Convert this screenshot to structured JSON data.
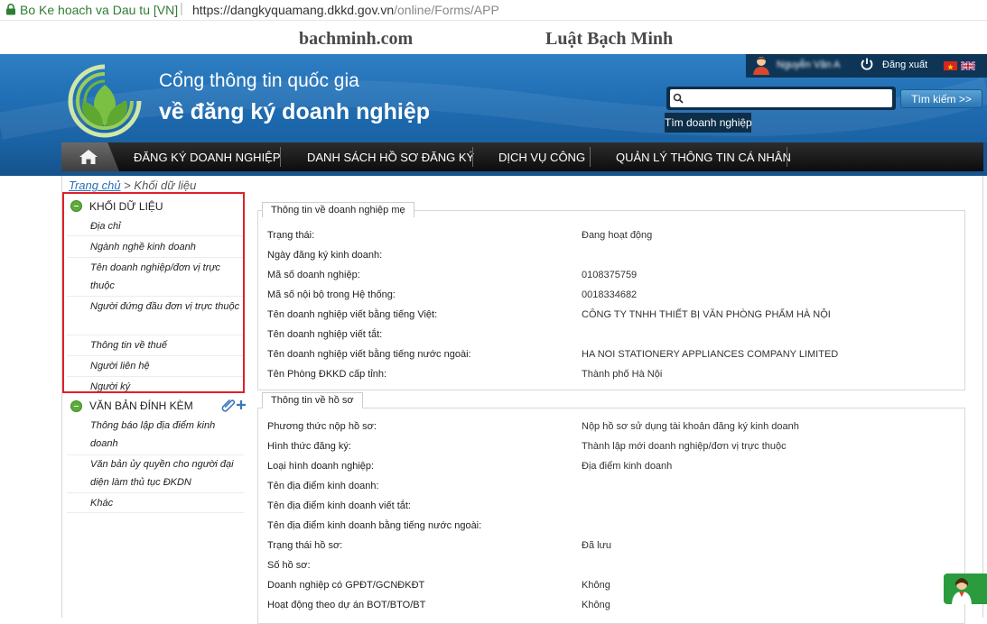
{
  "browser": {
    "site_name": "Bo Ke hoach va Dau tu [VN]",
    "separator": "|",
    "url_host": "https://dangkyquamang.dkkd.gov.vn",
    "url_path": "/online/Forms/APP"
  },
  "watermark": {
    "left": "bachminh.com",
    "right": "Luật Bạch Minh"
  },
  "header": {
    "title_line1": "Cổng thông tin quốc gia",
    "title_line2": "về đăng ký doanh nghiệp",
    "user_name": "Nguyễn Văn A",
    "logout_label": "Đăng xuất",
    "search_placeholder": "",
    "search_button": "Tìm kiếm >>",
    "find_business": "Tìm doanh nghiệp"
  },
  "nav": {
    "items": [
      "ĐĂNG KÝ DOANH NGHIỆP",
      "DANH SÁCH HỒ SƠ ĐĂNG KÝ",
      "DỊCH VỤ CÔNG",
      "QUẢN LÝ THÔNG TIN CÁ NHÂN"
    ]
  },
  "breadcrumb": {
    "home": "Trang chủ",
    "sep": ">",
    "current": "Khối dữ liệu"
  },
  "sidebar": {
    "data_title": "KHỐI DỮ LIỆU",
    "data_items": [
      "Địa chỉ",
      "Ngành nghề kinh doanh",
      "Tên doanh nghiệp/đơn vị trực thuộc",
      "Người đứng đầu đơn vị trực thuộc",
      "Thông tin về thuế",
      "Người liên hệ",
      "Người ký"
    ],
    "attach_title": "VĂN BẢN ĐÍNH KÈM",
    "attach_items": [
      "Thông báo lập địa điểm kinh doanh",
      "Văn bản ủy quyền cho người đại diện làm thủ tục ĐKDN",
      "Khác"
    ]
  },
  "parent_company": {
    "legend": "Thông tin về doanh nghiệp mẹ",
    "rows": [
      {
        "label": "Trạng thái:",
        "value": "Đang hoạt động"
      },
      {
        "label": "Ngày đăng ký kinh doanh:",
        "value": ""
      },
      {
        "label": "Mã số doanh nghiệp:",
        "value": "0108375759"
      },
      {
        "label": "Mã số nội bộ trong Hệ thống:",
        "value": "0018334682"
      },
      {
        "label": "Tên doanh nghiệp viết bằng tiếng Việt:",
        "value": "CÔNG TY TNHH THIẾT BỊ VĂN PHÒNG PHẨM HÀ NỘI"
      },
      {
        "label": "Tên doanh nghiệp viết tắt:",
        "value": ""
      },
      {
        "label": "Tên doanh nghiệp viết bằng tiếng nước ngoài:",
        "value": "HA NOI STATIONERY APPLIANCES COMPANY LIMITED"
      },
      {
        "label": "Tên Phòng ĐKKD cấp tỉnh:",
        "value": "Thành phố Hà Nội"
      }
    ]
  },
  "dossier": {
    "legend": "Thông tin về hồ sơ",
    "rows": [
      {
        "label": "Phương thức nộp hồ sơ:",
        "value": "Nộp hồ sơ sử dụng tài khoản đăng ký kinh doanh"
      },
      {
        "label": "Hình thức đăng ký:",
        "value": "Thành lập mới doanh nghiệp/đơn vị trực thuộc"
      },
      {
        "label": "Loại hình doanh nghiệp:",
        "value": "Địa điểm kinh doanh"
      },
      {
        "label": "Tên địa điểm kinh doanh:",
        "value": ""
      },
      {
        "label": "Tên địa điểm kinh doanh viết tắt:",
        "value": ""
      },
      {
        "label": "Tên địa điểm kinh doanh bằng tiếng nước ngoài:",
        "value": ""
      },
      {
        "label": "Trạng thái hồ sơ:",
        "value": "Đã lưu"
      },
      {
        "label": "Số hồ sơ:",
        "value": ""
      },
      {
        "label": "Doanh nghiệp có GPĐT/GCNĐKĐT",
        "value": "Không"
      },
      {
        "label": "Hoạt động theo dự án BOT/BTO/BT",
        "value": "Không"
      }
    ]
  },
  "colors": {
    "header_blue": "#1f6db3",
    "nav_dark": "#111111",
    "highlight_red": "#e0202a",
    "section_green": "#5cab3b"
  }
}
